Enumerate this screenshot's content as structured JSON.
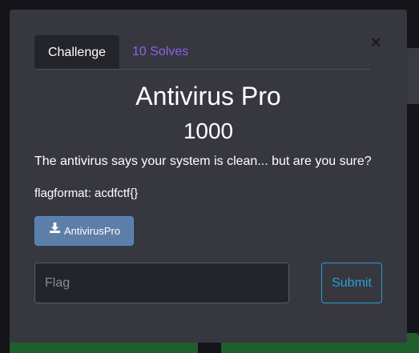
{
  "tabs": {
    "challenge": "Challenge",
    "solves": "10 Solves"
  },
  "close": {
    "glyph": "×"
  },
  "challenge": {
    "name": "Antivirus Pro",
    "points": "1000",
    "description": "The antivirus says your system is clean... but are you sure?",
    "flag_format": "flagformat: acdfctf{}"
  },
  "file": {
    "label": "AntivirusPro",
    "icon": "download-icon"
  },
  "flag": {
    "placeholder": "Flag",
    "value": ""
  },
  "submit": {
    "label": "Submit"
  },
  "colors": {
    "modal_bg": "#373740",
    "tab_link": "#8b63e8",
    "submit_accent": "#2a9fd6",
    "file_button": "#5d7ea6",
    "background_card": "#1f5f2c"
  }
}
